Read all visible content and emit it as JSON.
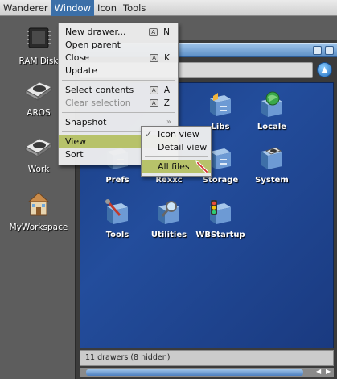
{
  "menubar": {
    "items": [
      "Wanderer",
      "Window",
      "Icon",
      "Tools"
    ],
    "active_index": 1
  },
  "desktop_icons": [
    {
      "label": "RAM Disk",
      "icon": "ram-disk-icon"
    },
    {
      "label": "AROS",
      "icon": "hard-disk-icon"
    },
    {
      "label": "Work",
      "icon": "hard-disk-icon"
    },
    {
      "label": "MyWorkspace",
      "icon": "home-drawer-icon"
    }
  ],
  "drawer": {
    "icons": [
      {
        "label": "Libs",
        "icon": "drawer-icon"
      },
      {
        "label": "Locale",
        "icon": "globe-drawer-icon"
      },
      {
        "label": "Prefs",
        "icon": "drawer-icon"
      },
      {
        "label": "Rexxc",
        "icon": "drawer-icon"
      },
      {
        "label": "Storage",
        "icon": "drawer-icon"
      },
      {
        "label": "System",
        "icon": "disk-drawer-icon"
      },
      {
        "label": "Tools",
        "icon": "tools-drawer-icon"
      },
      {
        "label": "Utilities",
        "icon": "magnifier-drawer-icon"
      },
      {
        "label": "WBStartup",
        "icon": "traffic-light-drawer-icon"
      }
    ],
    "status": "11 drawers (8 hidden)"
  },
  "window_menu": {
    "items": [
      {
        "label": "New drawer...",
        "shortcut": "N",
        "disabled": false
      },
      {
        "label": "Open parent",
        "shortcut": "",
        "disabled": false
      },
      {
        "label": "Close",
        "shortcut": "K",
        "disabled": false
      },
      {
        "label": "Update",
        "shortcut": "",
        "disabled": false
      },
      {
        "label": "Select contents",
        "shortcut": "A",
        "disabled": false
      },
      {
        "label": "Clear selection",
        "shortcut": "Z",
        "disabled": true
      },
      {
        "label": "Snapshot",
        "shortcut": "",
        "disabled": false,
        "submenu": true
      },
      {
        "label": "View",
        "shortcut": "",
        "disabled": false,
        "highlight": true
      },
      {
        "label": "Sort",
        "shortcut": "",
        "disabled": false
      }
    ],
    "amiga_key_glyph": "A",
    "submenu_glyph": "»"
  },
  "view_submenu": {
    "items": [
      {
        "label": "Icon view",
        "checked": true
      },
      {
        "label": "Detail view",
        "checked": false
      },
      {
        "label": "All files",
        "checked": false,
        "highlight": true
      }
    ],
    "check_glyph": "✓"
  },
  "colors": {
    "menu_highlight": "#b7c26a",
    "active_menu_title": "#3b6fa8",
    "drawer_background": "#1f4792"
  }
}
